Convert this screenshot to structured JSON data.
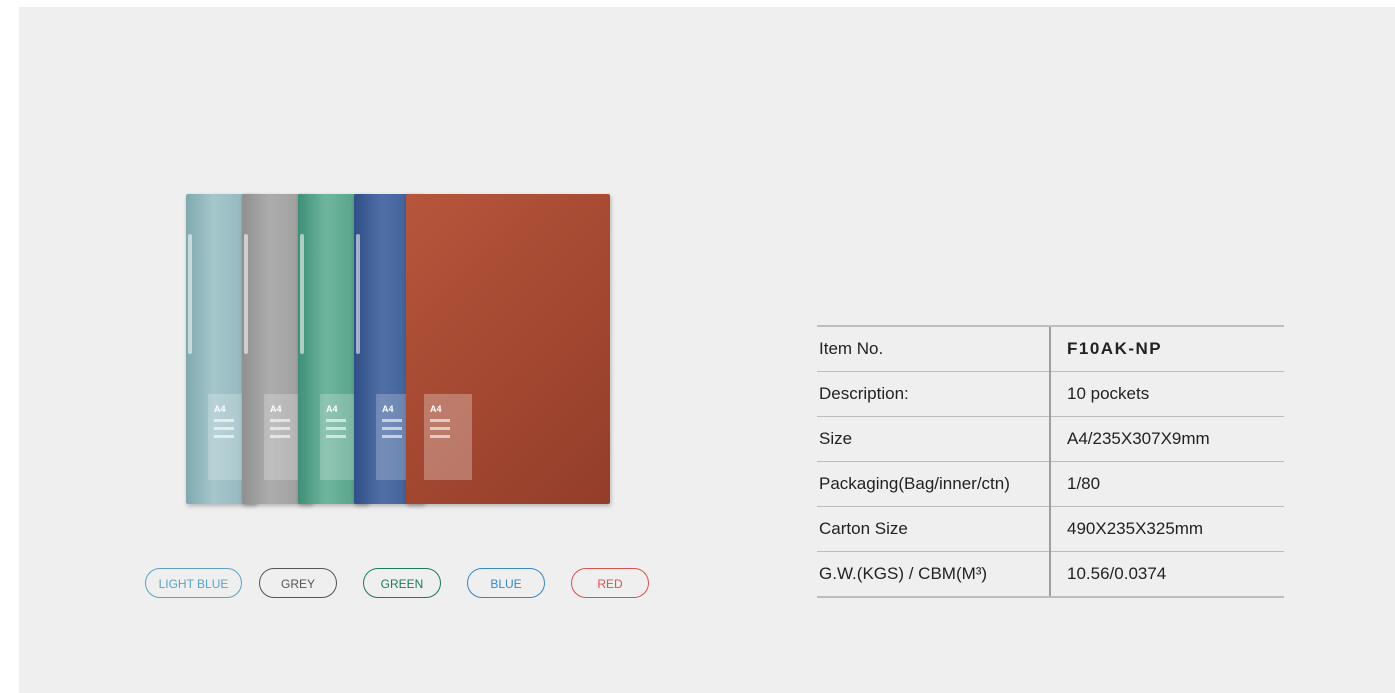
{
  "colors": {
    "background": "#efefef",
    "light_blue": "#5aa3c4",
    "grey": "#555555",
    "green": "#1f7a5a",
    "blue": "#3a86c8",
    "red": "#d9534f"
  },
  "product": {
    "folder_label": "A4"
  },
  "swatches": [
    {
      "label": "LIGHT BLUE"
    },
    {
      "label": "GREY"
    },
    {
      "label": "GREEN"
    },
    {
      "label": "BLUE"
    },
    {
      "label": "RED"
    }
  ],
  "spec_table": [
    {
      "key": "Item No.",
      "value": "F10AK-NP"
    },
    {
      "key": "Description:",
      "value": "10 pockets"
    },
    {
      "key": "Size",
      "value": "A4/235X307X9mm"
    },
    {
      "key": "Packaging(Bag/inner/ctn)",
      "value": "1/80"
    },
    {
      "key": "Carton Size",
      "value": "490X235X325mm"
    },
    {
      "key": "G.W.(KGS) / CBM(M³)",
      "value": "10.56/0.0374"
    }
  ]
}
